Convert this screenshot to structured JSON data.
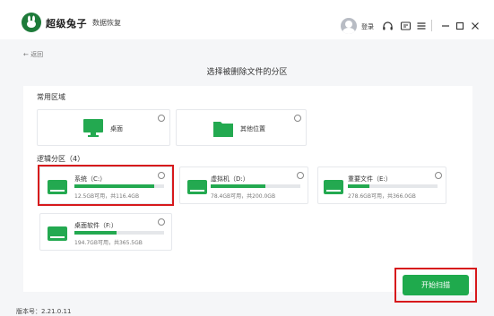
{
  "app": {
    "brand_name": "超级兔子",
    "brand_sub": "数据恢复",
    "login_label": "登录",
    "version_label": "版本号：2.21.0.11"
  },
  "nav": {
    "back_label": "返回",
    "page_title": "选择被删除文件的分区"
  },
  "common_area": {
    "title": "常用区域",
    "items": [
      {
        "label": "桌面",
        "icon": "monitor-icon"
      },
      {
        "label": "其他位置",
        "icon": "folder-icon"
      }
    ]
  },
  "logical_partitions": {
    "title": "逻辑分区（4）",
    "items": [
      {
        "label": "系统（C:）",
        "capacity": "12.5GB可用，共116.4GB",
        "used_fraction": 0.89
      },
      {
        "label": "虚拟机（D:）",
        "capacity": "78.4GB可用，共200.0GB",
        "used_fraction": 0.61
      },
      {
        "label": "重要文件（E:）",
        "capacity": "278.6GB可用，共366.0GB",
        "used_fraction": 0.24
      },
      {
        "label": "桌面软件（F:）",
        "capacity": "194.7GB可用，共365.5GB",
        "used_fraction": 0.47
      }
    ]
  },
  "actions": {
    "scan_label": "开始扫描"
  },
  "colors": {
    "accent": "#23a950",
    "highlight": "#d7191c"
  }
}
